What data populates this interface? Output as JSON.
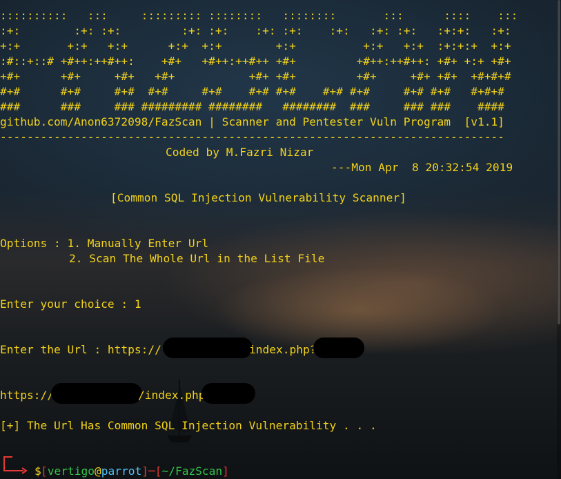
{
  "terminal": {
    "banner_lines": [
      "::::::::::   :::     ::::::::: ::::::::   ::::::::       :::      ::::    :::",
      ":+:        :+: :+:         :+: :+:    :+: :+:    :+:   :+: :+:   :+:+:   :+:",
      "+:+       +:+   +:+      +:+  +:+        +:+          +:+   +:+  :+:+:+  +:+",
      ":#::+::# +#++:++#++:    +#+   +#++:++#++ +#+         +#++:++#++: +#+ +:+ +#+",
      "+#+      +#+     +#+   +#+           +#+ +#+         +#+     +#+ +#+  +#+#+#",
      "#+#      #+#     #+#  #+#     #+#    #+# #+#    #+# #+#     #+# #+#   #+#+#",
      "###      ###     ### ######### ########   ########  ###     ### ###    ####"
    ],
    "repo_line": "github.com/Anon6372098/FazScan | Scanner and Pentester Vuln Program  [v1.1]",
    "divider": "---------------------------------------------------------------------------",
    "coded_by": "Coded by M.Fazri Nizar",
    "date_line": "---Mon Apr  8 20:32:54 2019",
    "scanner_title": "[Common SQL Injection Vulnerability Scanner]",
    "options_line1": "Options : 1. Manually Enter Url",
    "options_line2": "2. Scan The Whole Url in the List File",
    "choice_prompt": "Enter your choice : 1",
    "url_prompt_prefix": "Enter the Url : https://",
    "url_prompt_suffix": "index.php?",
    "result_url_prefix": "https://",
    "result_url_suffix": "/index.php?",
    "result_message": "[+] The Url Has Common SQL Injection Vulnerability . . .",
    "prompt": {
      "open_bracket": "[",
      "user": "vertigo",
      "at": "@",
      "host": "parrot",
      "close_bracket": "]",
      "dash": "─",
      "path_open": "[",
      "path": "~/FazScan",
      "path_close": "]",
      "dollar": "$"
    }
  },
  "colors": {
    "text": "#f2d21b",
    "prompt_red": "#e53935",
    "prompt_green": "#34c34a",
    "prompt_cyan": "#4fc3f7"
  }
}
